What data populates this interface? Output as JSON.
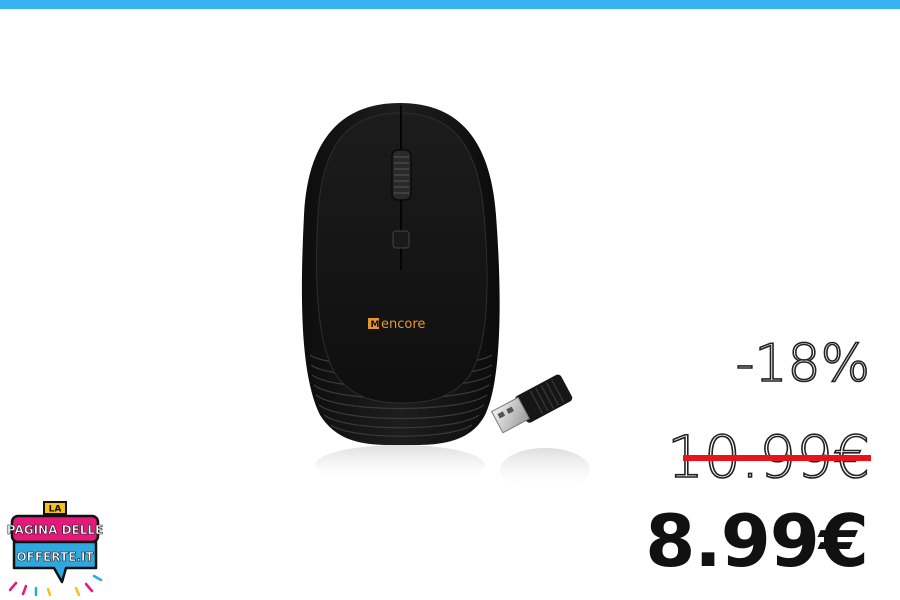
{
  "promo": {
    "discount": "-18%",
    "old_price": "10.99€",
    "new_price": "8.99€"
  },
  "product": {
    "brand": "encore",
    "image_icon": "wireless-mouse-with-usb-receiver"
  },
  "logo": {
    "line1": "LA",
    "line2": "PAGINA DELLE",
    "line3": "OFFERTE.IT"
  },
  "colors": {
    "top_bar": "#36b3f4",
    "strike": "#e8141b",
    "logo_pink": "#e5197b",
    "logo_blue": "#2fa8e0",
    "logo_yellow": "#f6c21a",
    "brand_orange": "#e8962a"
  }
}
